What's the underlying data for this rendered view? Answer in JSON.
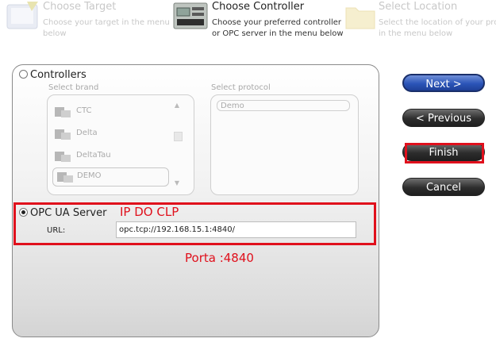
{
  "wizard_steps": [
    {
      "title": "Choose Target",
      "description_lines": [
        "Choose your target in the menu",
        "below"
      ],
      "state": "inactive"
    },
    {
      "title": "Choose Controller",
      "description_lines": [
        "Choose your preferred controller",
        "or OPC server in the menu below"
      ],
      "state": "active"
    },
    {
      "title": "Select Location",
      "description_lines": [
        "Select the location of your projec",
        "in the menu below"
      ],
      "state": "inactive"
    }
  ],
  "controllers": {
    "label": "Controllers",
    "select_brand_label": "Select brand",
    "select_protocol_label": "Select protocol",
    "brands": [
      "CTC",
      "Delta",
      "DeltaTau",
      "DEMO"
    ],
    "selected_brand": "DEMO",
    "protocols": [
      "Demo"
    ]
  },
  "opc": {
    "label": "OPC UA Server",
    "url_label": "URL:",
    "url_value": "opc.tcp://192.168.15.1:4840/"
  },
  "annotations": {
    "ip": "IP DO CLP",
    "port": "Porta :4840",
    "color": "#e0101c"
  },
  "buttons": {
    "next": "Next >",
    "previous": "< Previous",
    "finish": "Finish",
    "cancel": "Cancel"
  },
  "colors": {
    "primary_button": "#2b55b8",
    "dark_button": "#2d2d2d"
  }
}
